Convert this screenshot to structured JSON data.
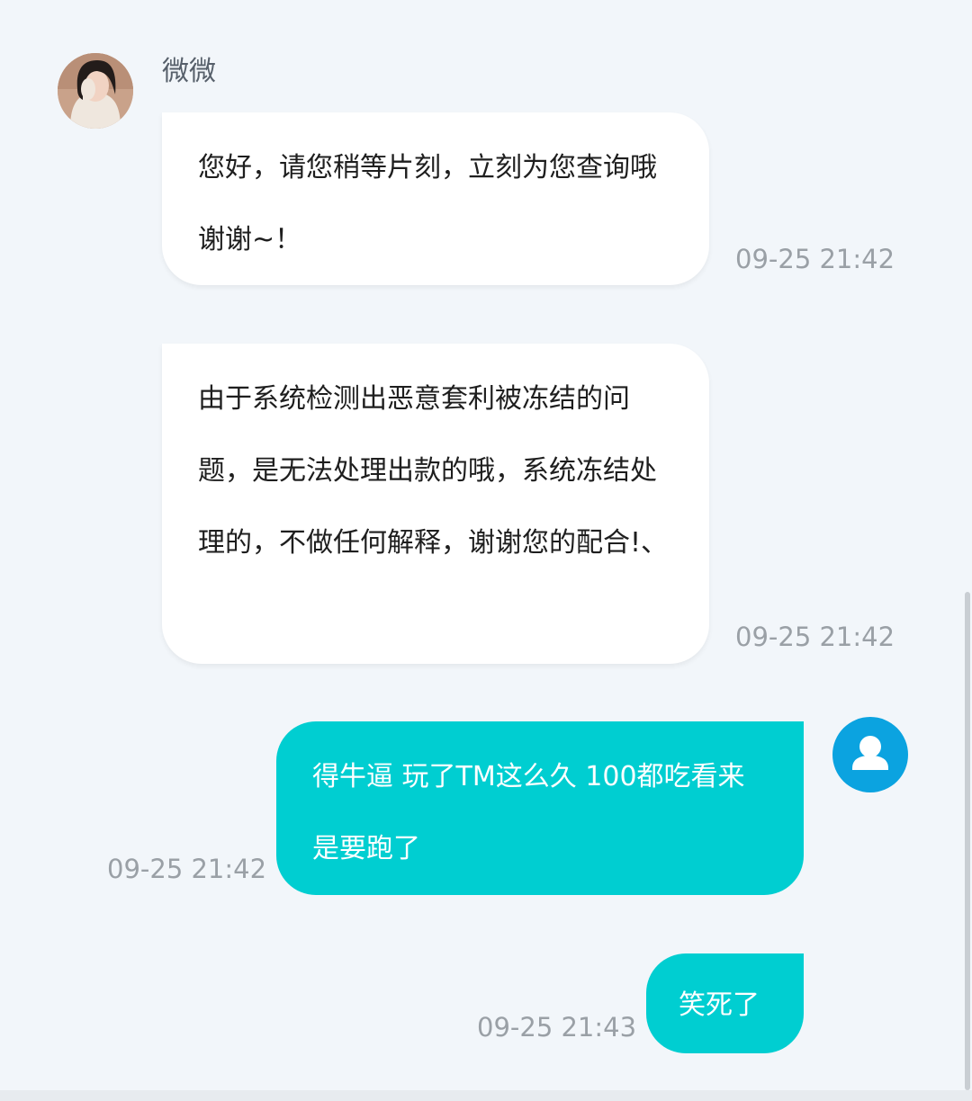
{
  "conversation": {
    "agent_name": "微微",
    "messages": [
      {
        "from": "agent",
        "text": "您好，请您稍等片刻，立刻为您查询哦谢谢~！",
        "time": "09-25 21:42"
      },
      {
        "from": "agent",
        "text": "由于系统检测出恶意套利被冻结的问题，是无法处理出款的哦，系统冻结处理的，不做任何解释，谢谢您的配合!、",
        "time": "09-25 21:42"
      },
      {
        "from": "user",
        "text": "得牛逼 玩了TM这么久 100都吃看来是要跑了",
        "time": "09-25 21:42"
      },
      {
        "from": "user",
        "text": "笑死了",
        "time": "09-25 21:43"
      }
    ]
  },
  "icons": {
    "agent_avatar": "agent-photo-avatar",
    "user_avatar": "user-silhouette-icon"
  },
  "colors": {
    "background": "#f2f6fa",
    "incoming_bubble": "#ffffff",
    "outgoing_bubble": "#00ced1",
    "user_avatar": "#0ba3e0",
    "timestamp": "#9aa0a6"
  }
}
